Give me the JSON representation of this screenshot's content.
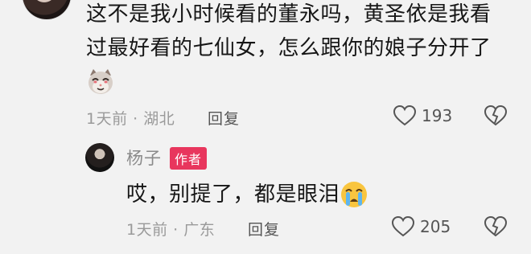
{
  "comment": {
    "line1": "这不是我小时候看的董永吗，黄圣依是我看",
    "line2": "过最好看的七仙女，怎么跟你的娘子分开了",
    "emoji": "cat-face-emoji",
    "time": "1天前",
    "location": "湖北",
    "reply_label": "回复",
    "likes": "193"
  },
  "reply": {
    "username": "杨子",
    "badge": "作者",
    "text": "哎，别提了，都是眼泪",
    "emoji": "crying-face-emoji",
    "time": "1天前",
    "location": "广东",
    "reply_label": "回复",
    "likes": "205"
  },
  "icons": {
    "like": "heart-outline-icon",
    "dislike": "broken-heart-icon"
  },
  "colors": {
    "badge": "#e8365d",
    "meta_text": "#9a9a9a",
    "background": "#f2f2f2"
  }
}
